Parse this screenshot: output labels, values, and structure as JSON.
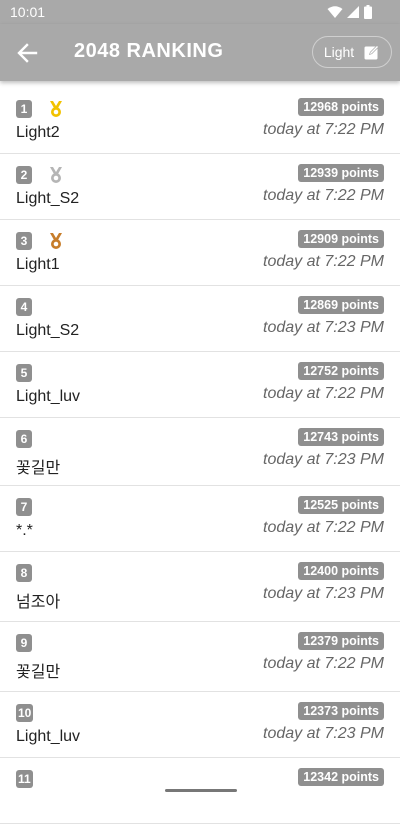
{
  "status_bar": {
    "time": "10:01"
  },
  "app_bar": {
    "title": "2048 RANKING",
    "theme_label": "Light"
  },
  "colors": {
    "bar": "#a9a9a9",
    "badge": "#8f8f8f",
    "gold": "#f2c200",
    "silver": "#b5b5b5",
    "bronze": "#c77d2a"
  },
  "rankings": [
    {
      "rank": "1",
      "name": "Light2",
      "points": "12968 points",
      "time": "today at 7:22 PM",
      "medal": "gold"
    },
    {
      "rank": "2",
      "name": "Light_S2",
      "points": "12939 points",
      "time": "today at 7:22 PM",
      "medal": "silver"
    },
    {
      "rank": "3",
      "name": "Light1",
      "points": "12909 points",
      "time": "today at 7:22 PM",
      "medal": "bronze"
    },
    {
      "rank": "4",
      "name": "Light_S2",
      "points": "12869 points",
      "time": "today at 7:23 PM"
    },
    {
      "rank": "5",
      "name": "Light_luv",
      "points": "12752 points",
      "time": "today at 7:22 PM"
    },
    {
      "rank": "6",
      "name": "꽃길만",
      "points": "12743 points",
      "time": "today at 7:23 PM"
    },
    {
      "rank": "7",
      "name": "*.*",
      "points": "12525 points",
      "time": "today at 7:22 PM"
    },
    {
      "rank": "8",
      "name": "넘조아",
      "points": "12400 points",
      "time": "today at 7:23 PM"
    },
    {
      "rank": "9",
      "name": "꽃길만",
      "points": "12379 points",
      "time": "today at 7:22 PM"
    },
    {
      "rank": "10",
      "name": "Light_luv",
      "points": "12373 points",
      "time": "today at 7:23 PM"
    },
    {
      "rank": "11",
      "name": "",
      "points": "12342 points",
      "time": ""
    }
  ]
}
